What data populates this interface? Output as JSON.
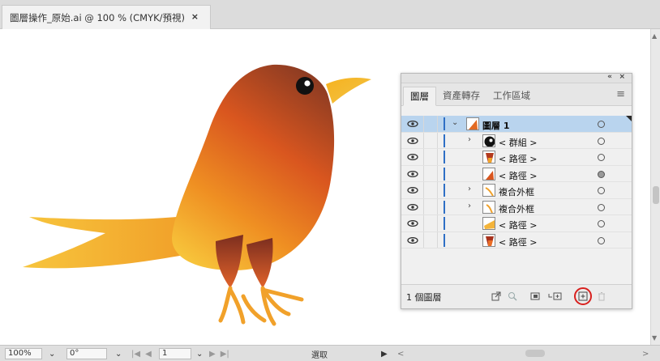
{
  "document_tab": {
    "title": "圖層操作_原始.ai @ 100 % (CMYK/預視)",
    "close": "×"
  },
  "panel": {
    "collapse_icon": "«",
    "close_icon": "×",
    "tabs": [
      "圖層",
      "資產轉存",
      "工作區域"
    ],
    "menu_icon": "≡",
    "rows": [
      {
        "name": "圖層 1",
        "chevron": "⌄",
        "bold": true
      },
      {
        "name": "< 群組 >",
        "chevron": "›"
      },
      {
        "name": "< 路徑 >",
        "chevron": ""
      },
      {
        "name": "< 路徑 >",
        "chevron": ""
      },
      {
        "name": "複合外框",
        "chevron": "›"
      },
      {
        "name": "複合外框",
        "chevron": "›"
      },
      {
        "name": "< 路徑 >",
        "chevron": ""
      },
      {
        "name": "< 路徑 >",
        "chevron": ""
      }
    ],
    "footer": {
      "layer_count": "1 個圖層"
    }
  },
  "statusbar": {
    "zoom": "100%",
    "rotation": "0°",
    "artboard": "1",
    "tool": "選取",
    "first": "|◀",
    "prev": "◀",
    "next": "▶",
    "last": "▶|",
    "play": "▶",
    "scroll_left": "<",
    "scroll_right": ">",
    "dropdown": "⌄"
  },
  "colors": {
    "accent": "#2f6fc5",
    "selection": "#b9d4ee",
    "highlight_ring": "#d8201e"
  }
}
